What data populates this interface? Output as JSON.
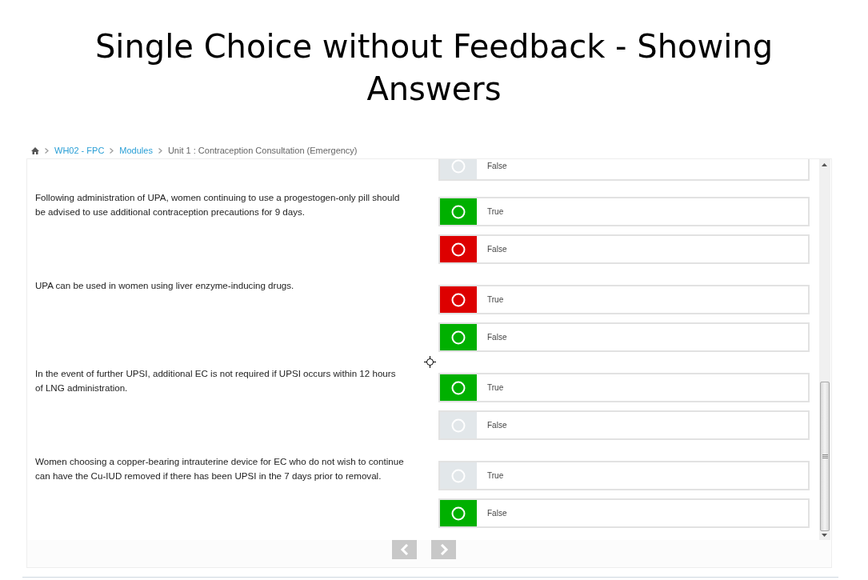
{
  "title": "Single Choice without Feedback - Showing Answers",
  "breadcrumb": {
    "links": [
      "WH02 - FPC",
      "Modules"
    ],
    "current": "Unit 1 : Contraception Consultation (Emergency)"
  },
  "partial_option": {
    "label": "False",
    "color": "#e2e7ea"
  },
  "questions": [
    {
      "text": "Following administration of UPA, women continuing to use a progestogen-only pill should be advised to use additional contraception precautions for 9 days.",
      "options": [
        {
          "label": "True",
          "color": "#00b000"
        },
        {
          "label": "False",
          "color": "#dd0000"
        }
      ]
    },
    {
      "text": "UPA can be used in women using liver enzyme-inducing drugs.",
      "options": [
        {
          "label": "True",
          "color": "#dd0000"
        },
        {
          "label": "False",
          "color": "#00b000"
        }
      ]
    },
    {
      "text": "In the event of further UPSI, additional EC is not required if UPSI occurs within 12 hours of LNG administration.",
      "options": [
        {
          "label": "True",
          "color": "#00b000"
        },
        {
          "label": "False",
          "color": "#e2e7ea"
        }
      ]
    },
    {
      "text": "Women choosing a copper-bearing intrauterine device for EC who do not wish to continue can have the Cu-IUD removed if there has been UPSI in the 7 days prior to removal.",
      "options": [
        {
          "label": "True",
          "color": "#e2e7ea"
        },
        {
          "label": "False",
          "color": "#00b000"
        }
      ]
    }
  ]
}
